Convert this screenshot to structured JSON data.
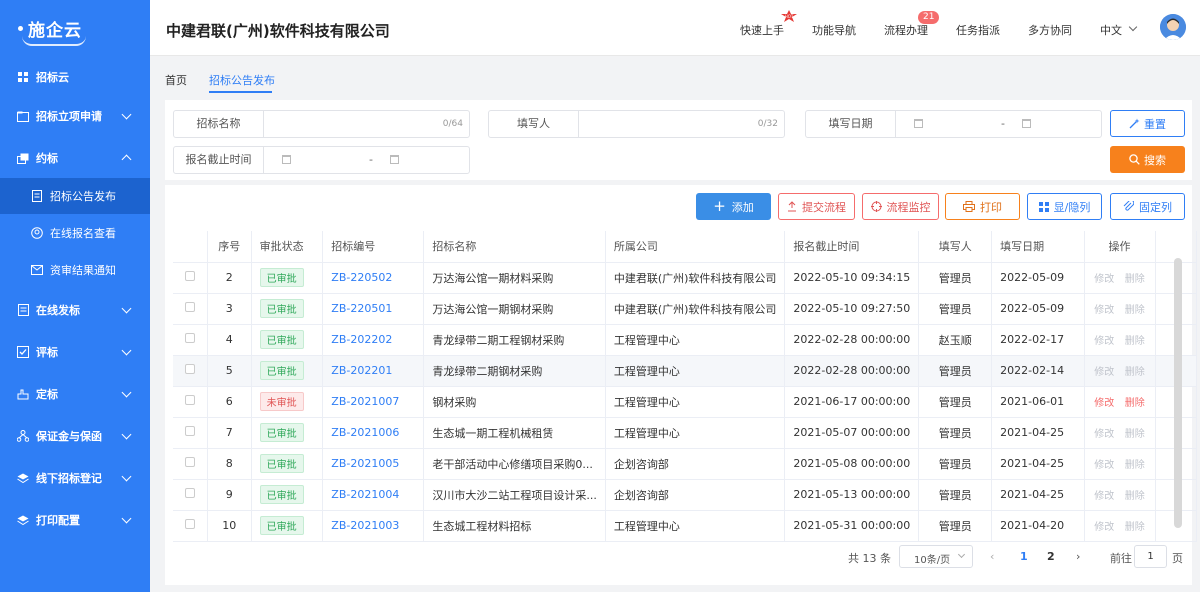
{
  "sidebar": {
    "logo": "施企云",
    "items": [
      {
        "label": "招标云",
        "icon": "grid-icon"
      },
      {
        "label": "招标立项申请",
        "icon": "folder-icon"
      },
      {
        "label": "约标",
        "icon": "stack-icon"
      },
      {
        "label": "招标公告发布",
        "icon": "document-icon"
      },
      {
        "label": "在线报名查看",
        "icon": "user-circle-icon"
      },
      {
        "label": "资审结果通知",
        "icon": "mail-icon"
      },
      {
        "label": "在线发标",
        "icon": "sheet-icon"
      },
      {
        "label": "评标",
        "icon": "checklist-icon"
      },
      {
        "label": "定标",
        "icon": "hand-icon"
      },
      {
        "label": "保证金与保函",
        "icon": "org-icon"
      },
      {
        "label": "线下招标登记",
        "icon": "layers-icon"
      },
      {
        "label": "打印配置",
        "icon": "layers-icon"
      }
    ]
  },
  "header": {
    "company": "中建君联(广州)软件科技有限公司",
    "nav": [
      "快速上手",
      "功能导航",
      "流程办理",
      "任务指派",
      "多方协同",
      "中文"
    ],
    "badge": "21",
    "hot_label": "HOT"
  },
  "breadcrumb": {
    "home": "首页",
    "current": "招标公告发布"
  },
  "filters": {
    "bid_name": {
      "label": "招标名称",
      "count": "0/64"
    },
    "writer": {
      "label": "填写人",
      "count": "0/32"
    },
    "fill_date": {
      "label": "填写日期",
      "sep": "-"
    },
    "deadline": {
      "label": "报名截止时间",
      "sep": "-"
    },
    "reset": "重置",
    "search": "搜索"
  },
  "toolbar": {
    "add": "添加",
    "submit": "提交流程",
    "monitor": "流程监控",
    "print": "打印",
    "columns": "显/隐列",
    "pin": "固定列"
  },
  "table": {
    "headers": [
      "序号",
      "审批状态",
      "招标编号",
      "招标名称",
      "所属公司",
      "报名截止时间",
      "填写人",
      "填写日期",
      "操作"
    ],
    "rows": [
      {
        "no": "2",
        "status": "已审批",
        "code": "ZB-220502",
        "name": "万达海公馆一期材料采购",
        "company": "中建君联(广州)软件科技有限公司",
        "deadline": "2022-05-10 09:34:15",
        "writer": "管理员",
        "date": "2022-05-09",
        "edit": "修改",
        "del": "删除",
        "approved": true
      },
      {
        "no": "3",
        "status": "已审批",
        "code": "ZB-220501",
        "name": "万达海公馆一期钢材采购",
        "company": "中建君联(广州)软件科技有限公司",
        "deadline": "2022-05-10 09:27:50",
        "writer": "管理员",
        "date": "2022-05-09",
        "edit": "修改",
        "del": "删除",
        "approved": true
      },
      {
        "no": "4",
        "status": "已审批",
        "code": "ZB-202202",
        "name": "青龙绿带二期工程钢材采购",
        "company": "工程管理中心",
        "deadline": "2022-02-28 00:00:00",
        "writer": "赵玉顺",
        "date": "2022-02-17",
        "edit": "修改",
        "del": "删除",
        "approved": true
      },
      {
        "no": "5",
        "status": "已审批",
        "code": "ZB-202201",
        "name": "青龙绿带二期钢材采购",
        "company": "工程管理中心",
        "deadline": "2022-02-28 00:00:00",
        "writer": "管理员",
        "date": "2022-02-14",
        "edit": "修改",
        "del": "删除",
        "approved": true
      },
      {
        "no": "6",
        "status": "未审批",
        "code": "ZB-2021007",
        "name": "钢材采购",
        "company": "工程管理中心",
        "deadline": "2021-06-17 00:00:00",
        "writer": "管理员",
        "date": "2021-06-01",
        "edit": "修改",
        "del": "删除",
        "approved": false
      },
      {
        "no": "7",
        "status": "已审批",
        "code": "ZB-2021006",
        "name": "生态城一期工程机械租赁",
        "company": "工程管理中心",
        "deadline": "2021-05-07 00:00:00",
        "writer": "管理员",
        "date": "2021-04-25",
        "edit": "修改",
        "del": "删除",
        "approved": true
      },
      {
        "no": "8",
        "status": "已审批",
        "code": "ZB-2021005",
        "name": "老干部活动中心修缮项目采购0...",
        "company": "企划咨询部",
        "deadline": "2021-05-08 00:00:00",
        "writer": "管理员",
        "date": "2021-04-25",
        "edit": "修改",
        "del": "删除",
        "approved": true
      },
      {
        "no": "9",
        "status": "已审批",
        "code": "ZB-2021004",
        "name": "汉川市大沙二站工程项目设计采...",
        "company": "企划咨询部",
        "deadline": "2021-05-13 00:00:00",
        "writer": "管理员",
        "date": "2021-04-25",
        "edit": "修改",
        "del": "删除",
        "approved": true
      },
      {
        "no": "10",
        "status": "已审批",
        "code": "ZB-2021003",
        "name": "生态城工程材料招标",
        "company": "工程管理中心",
        "deadline": "2021-05-31 00:00:00",
        "writer": "管理员",
        "date": "2021-04-20",
        "edit": "修改",
        "del": "删除",
        "approved": true
      }
    ]
  },
  "pagination": {
    "total": "共 13 条",
    "size": "10条/页",
    "pages": [
      "1",
      "2"
    ],
    "goto": "前往",
    "goto_value": "1",
    "page_unit": "页"
  },
  "colors": {
    "primary": "#2f7ef5",
    "orange": "#f7811c",
    "red": "#f56c6c",
    "green": "#2fa85a"
  }
}
